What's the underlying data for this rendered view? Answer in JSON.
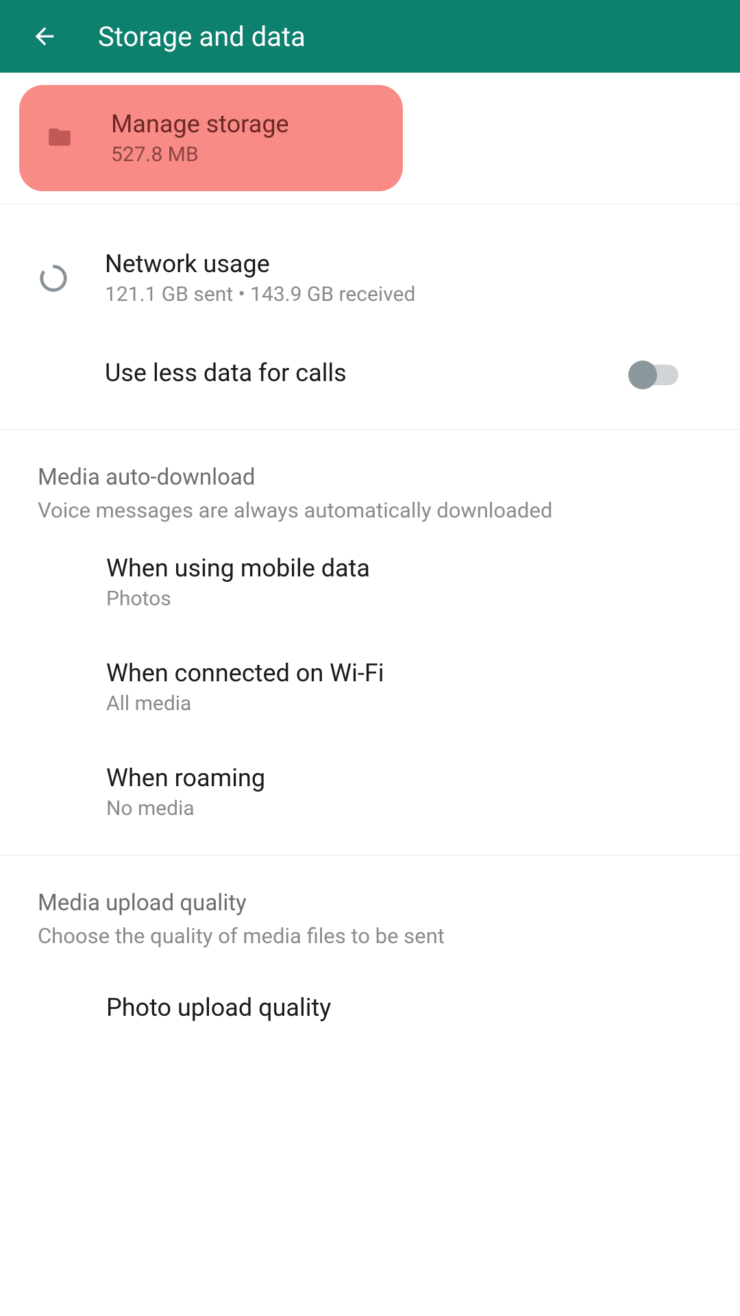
{
  "header": {
    "title": "Storage and data"
  },
  "manage_storage": {
    "title": "Manage storage",
    "subtitle": "527.8 MB"
  },
  "network_usage": {
    "title": "Network usage",
    "subtitle": "121.1 GB sent • 143.9 GB received"
  },
  "use_less_data": {
    "title": "Use less data for calls"
  },
  "media_auto_download": {
    "section_title": "Media auto-download",
    "section_subtitle": "Voice messages are always automatically downloaded",
    "mobile_data": {
      "title": "When using mobile data",
      "subtitle": "Photos"
    },
    "wifi": {
      "title": "When connected on Wi-Fi",
      "subtitle": "All media"
    },
    "roaming": {
      "title": "When roaming",
      "subtitle": "No media"
    }
  },
  "media_upload_quality": {
    "section_title": "Media upload quality",
    "section_subtitle": "Choose the quality of media files to be sent",
    "photo_quality": {
      "title": "Photo upload quality"
    }
  }
}
